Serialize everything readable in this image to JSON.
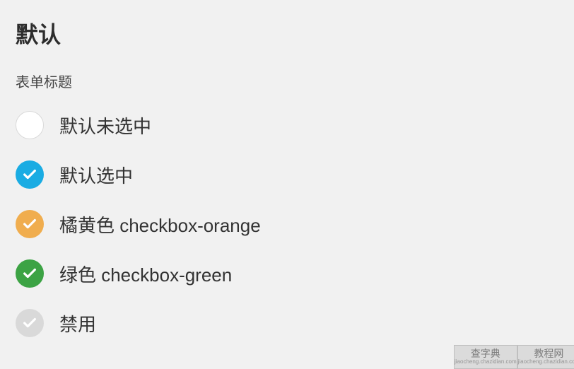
{
  "heading": "默认",
  "form_title": "表单标题",
  "items": [
    {
      "label": "默认未选中",
      "variant": "unchecked",
      "checked": false,
      "disabled": false
    },
    {
      "label": "默认选中",
      "variant": "default",
      "checked": true,
      "disabled": false
    },
    {
      "label": "橘黄色 checkbox-orange",
      "variant": "orange",
      "checked": true,
      "disabled": false
    },
    {
      "label": "绿色 checkbox-green",
      "variant": "green",
      "checked": true,
      "disabled": false
    },
    {
      "label": "禁用",
      "variant": "disabled",
      "checked": true,
      "disabled": true
    }
  ],
  "watermark": {
    "left_main": "查字典",
    "left_sub": "jiaocheng.chazidian.com",
    "right_main": "教程网",
    "right_sub": "jiaocheng.chazidian.com"
  },
  "colors": {
    "default": "#1aace3",
    "orange": "#f0ad4e",
    "green": "#3ca344",
    "disabled": "#d9d9d9",
    "unchecked_bg": "#ffffff"
  }
}
